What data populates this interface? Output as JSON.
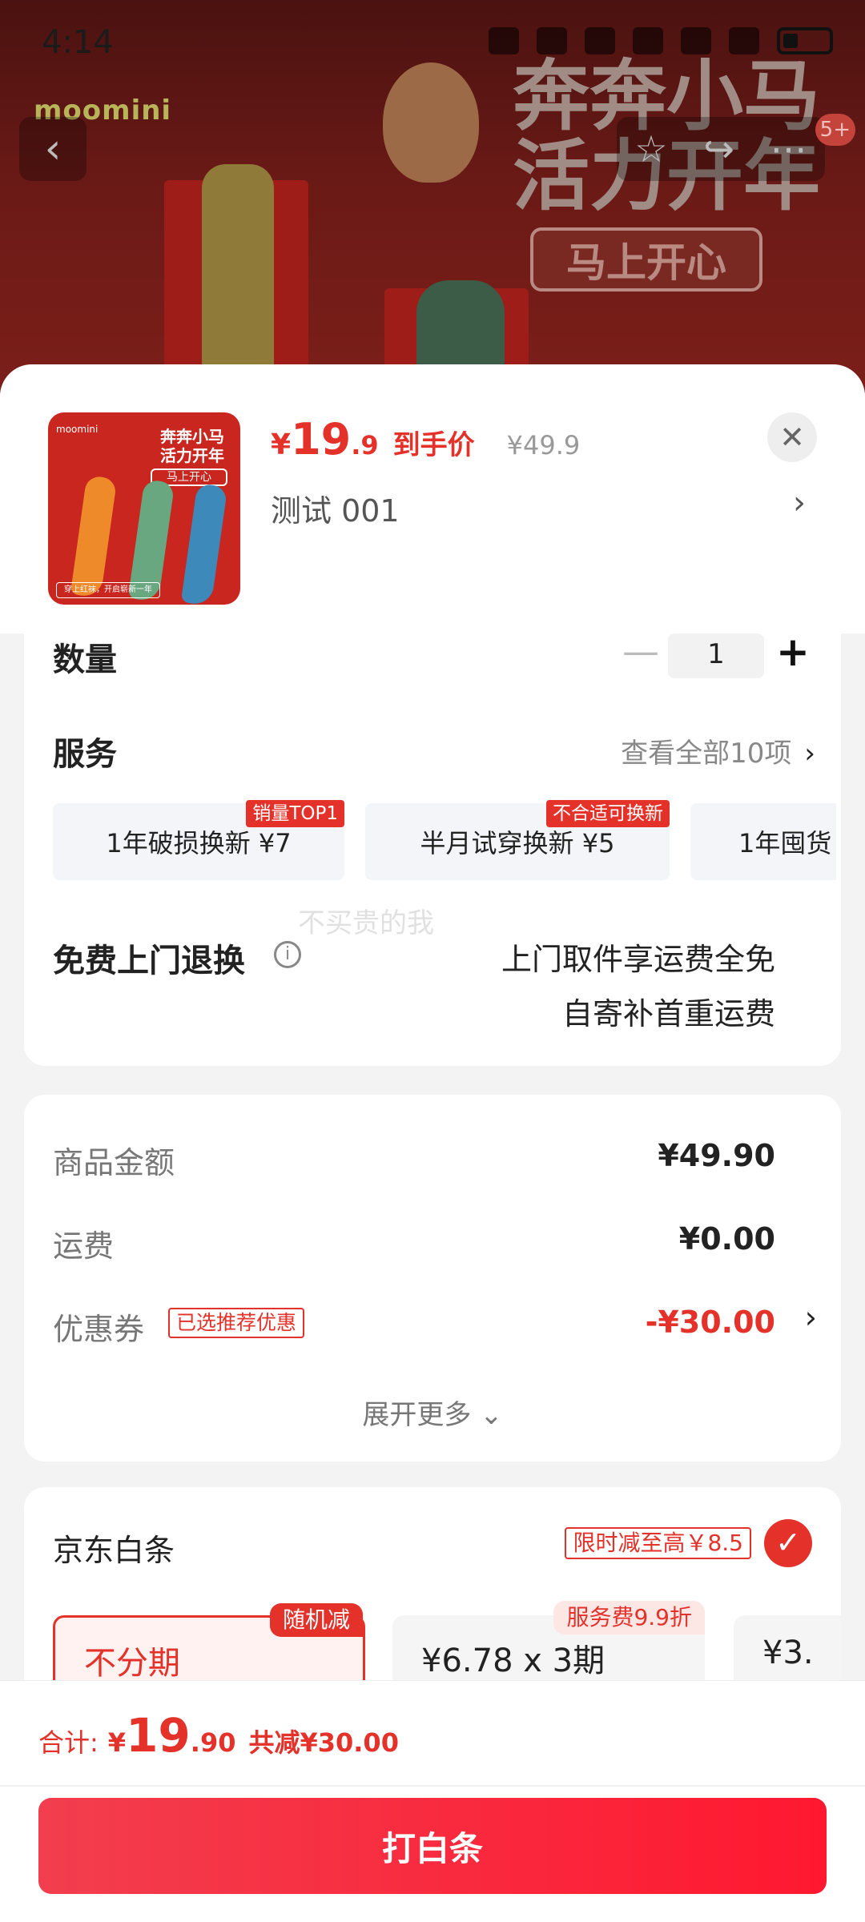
{
  "status_bar": {
    "time": "4:14"
  },
  "banner": {
    "brand": "moomini",
    "title_line1": "奔奔小马",
    "title_line2": "活力开年",
    "ribbon": "马上开心",
    "notification_count": "5+",
    "back_glyph": "‹",
    "star_glyph": "☆",
    "share_glyph": "↪",
    "more_glyph": "⋯"
  },
  "product": {
    "thumb": {
      "brand": "moomini",
      "title_line1": "奔奔小马",
      "title_line2": "活力开年",
      "ribbon": "马上开心",
      "footer": "穿上红袜，开启崭新一年"
    },
    "price_symbol": "¥",
    "price_int": "19",
    "price_dec": ".9",
    "price_label": "到手价",
    "original_price": "¥49.9",
    "spec": "测试  001"
  },
  "quantity": {
    "label": "数量",
    "value": "1",
    "minus": "—",
    "plus": "+"
  },
  "services": {
    "label": "服务",
    "view_all": "查看全部10项",
    "items": [
      {
        "text": "1年破损换新  ¥7",
        "tag": "销量TOP1"
      },
      {
        "text": "半月试穿换新  ¥5",
        "tag": "不合适可换新"
      },
      {
        "text": "1年囤货",
        "tag": ""
      }
    ]
  },
  "returns": {
    "label": "免费上门退换",
    "line1": "上门取件享运费全免",
    "line2": "自寄补首重运费"
  },
  "watermark": "不买贵的我",
  "summary": {
    "goods_label": "商品金额",
    "goods_value": "¥49.90",
    "shipping_label": "运费",
    "shipping_value": "¥0.00",
    "coupon_label": "优惠券",
    "coupon_tag": "已选推荐优惠",
    "coupon_value": "-¥30.00",
    "expand": "展开更多 ⌄"
  },
  "baitiao": {
    "label": "京东白条",
    "promo": "限时减至高￥8.5",
    "plans": [
      {
        "text": "不分期",
        "tag": "随机减",
        "selected": true
      },
      {
        "text": "¥6.78 x 3期",
        "tag": "服务费9.9折",
        "selected": false
      },
      {
        "text": "¥3.",
        "tag": "",
        "selected": false
      }
    ]
  },
  "bottom": {
    "total_label": "合计:",
    "total_symbol": "¥",
    "total_int": "19",
    "total_dec": ".90",
    "total_saving": "共减¥30.00",
    "pay_button": "打白条"
  },
  "colors": {
    "accent": "#e4322b",
    "button_gradient_start": "#f23e4e",
    "button_gradient_end": "#ff1830"
  }
}
